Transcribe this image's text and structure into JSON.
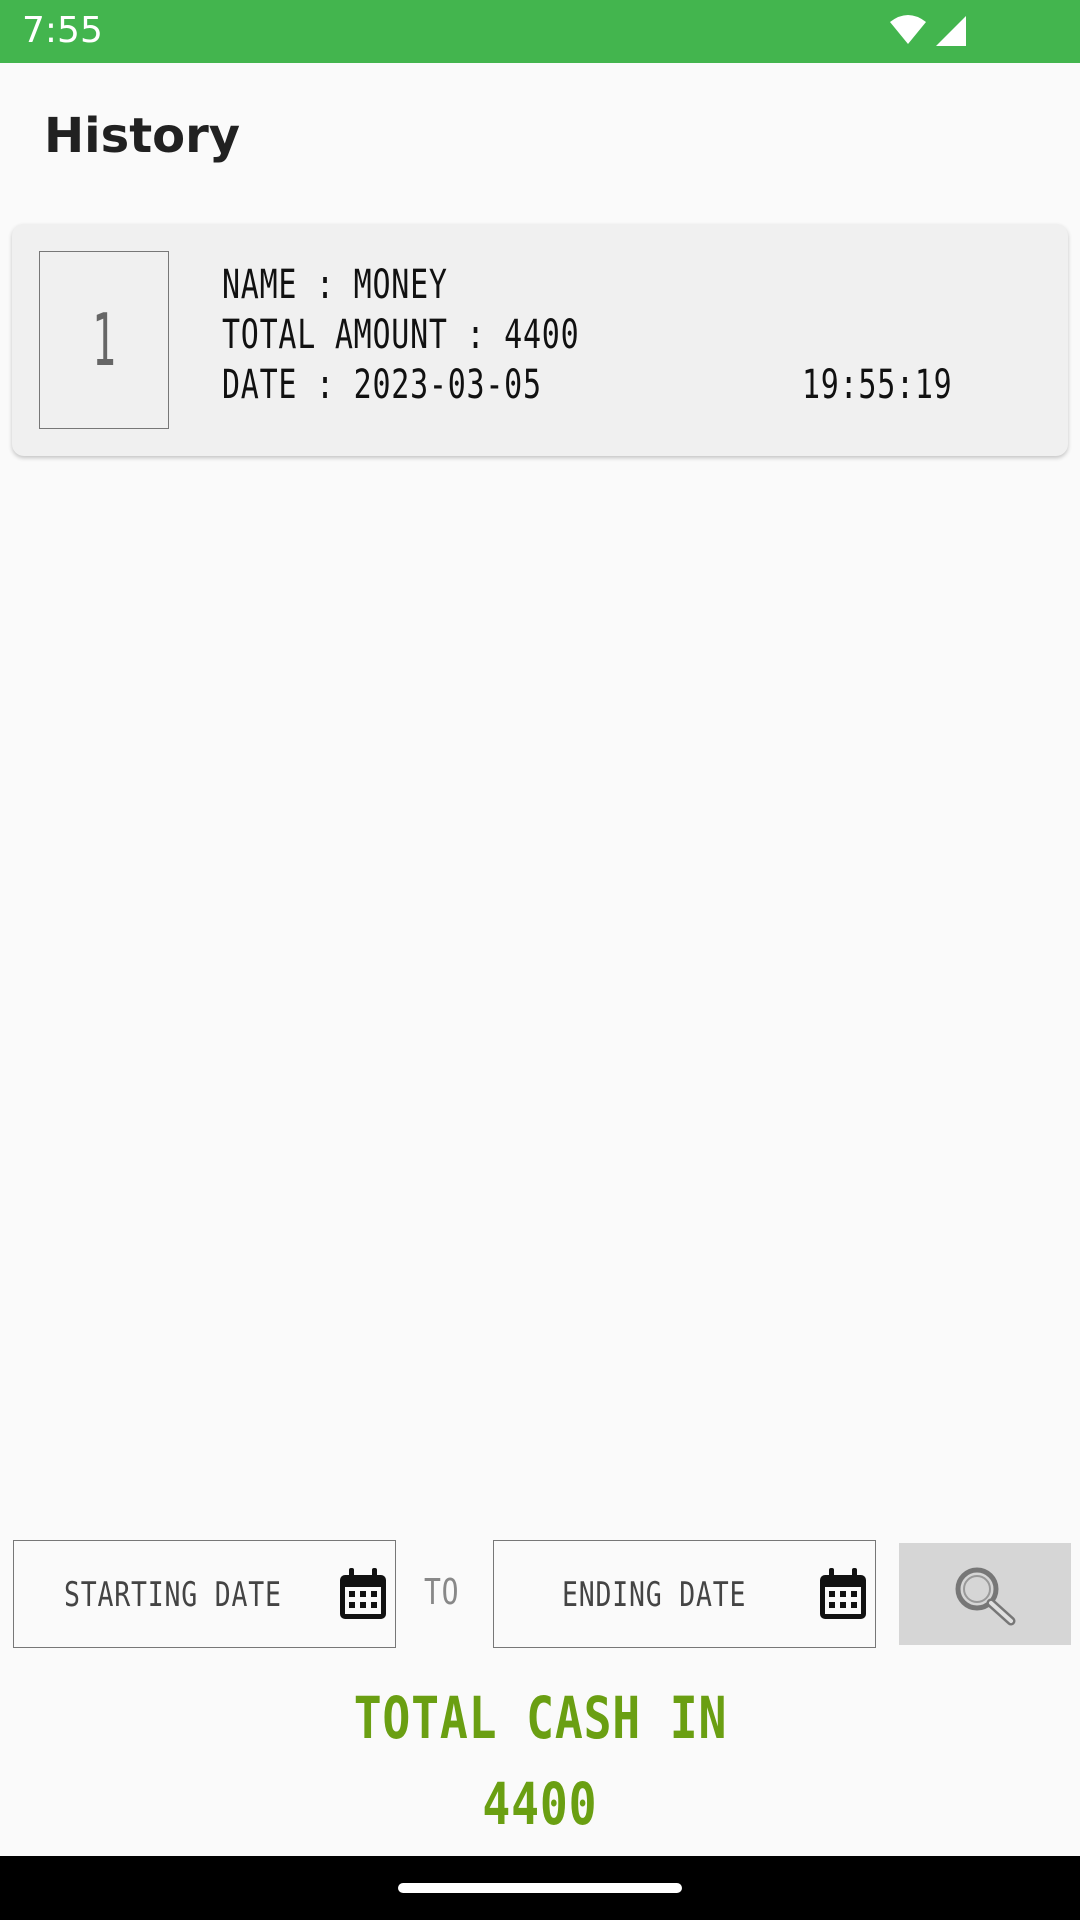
{
  "status_bar": {
    "time": "7:55",
    "background": "#43b54e"
  },
  "app_bar": {
    "title": "History"
  },
  "history": [
    {
      "index": "1",
      "name_line": "NAME :  MONEY",
      "amount_line": "TOTAL AMOUNT : 4400",
      "date_line": "DATE : 2023-03-05",
      "time": "19:55:19"
    }
  ],
  "filter": {
    "start_label": "STARTING DATE",
    "to_label": "TO",
    "end_label": "ENDING DATE",
    "start_icon": "calendar-icon",
    "end_icon": "calendar-icon",
    "search_icon": "search-icon"
  },
  "total": {
    "label": "TOTAL CASH IN",
    "value": "4400",
    "color": "#6a9f12"
  }
}
